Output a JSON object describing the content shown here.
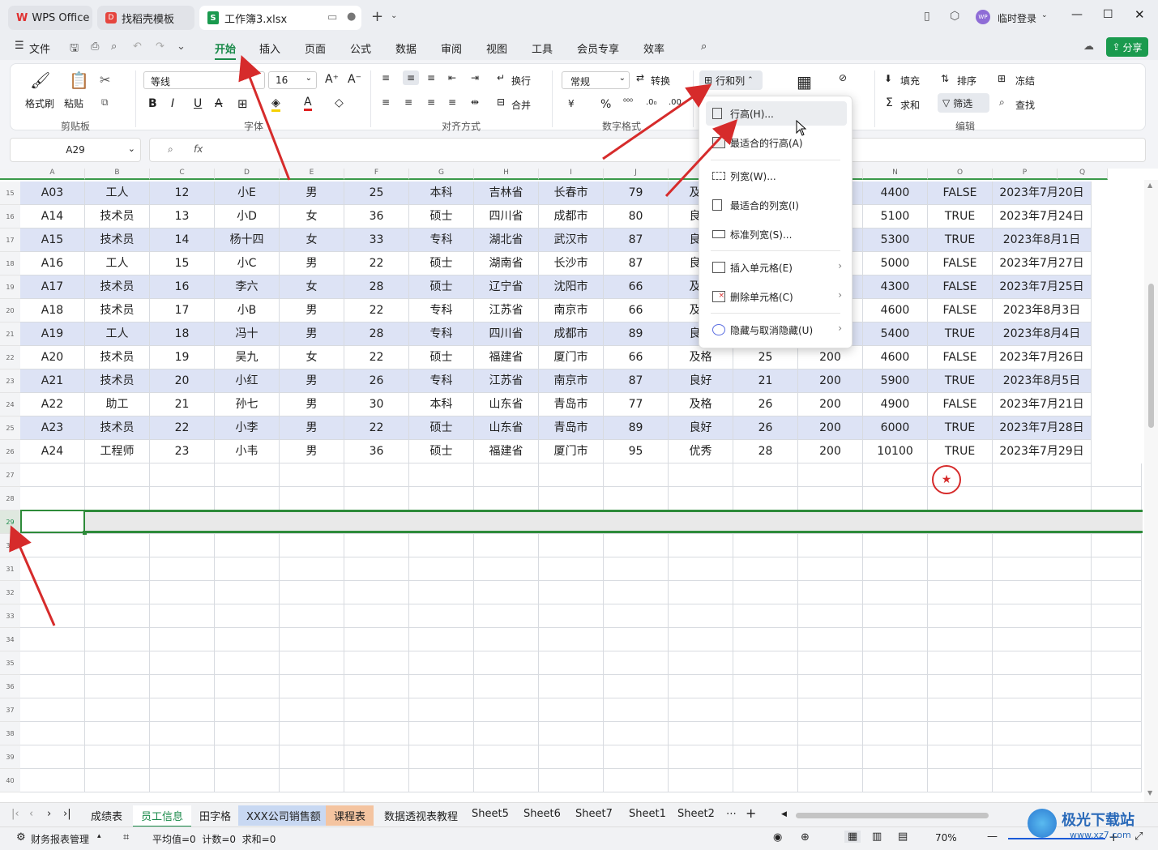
{
  "titlebar": {
    "tabs": [
      {
        "label": "WPS Office"
      },
      {
        "label": "找稻壳模板"
      },
      {
        "label": "工作簿3.xlsx"
      }
    ],
    "user_label": "临时登录",
    "avatar_text": "WP"
  },
  "menubar": {
    "file_label": "文件",
    "items": [
      "开始",
      "插入",
      "页面",
      "公式",
      "数据",
      "审阅",
      "视图",
      "工具",
      "会员专享",
      "效率"
    ],
    "share_label": "分享"
  },
  "ribbon": {
    "format_painter": "格式刷",
    "paste": "粘贴",
    "clipboard_group": "剪贴板",
    "font_name": "等线",
    "font_size": "16",
    "font_group": "字体",
    "wrap": "换行",
    "merge": "合并",
    "align_group": "对齐方式",
    "number_format": "常规",
    "convert": "转换",
    "currency_symbol": "¥",
    "percent_symbol": "%",
    "number_group": "数字格式",
    "rows_cols": "行和列",
    "fill": "填充",
    "sort": "排序",
    "freeze": "冻结",
    "sum": "求和",
    "filter": "筛选",
    "find": "查找",
    "edit_group": "编辑"
  },
  "formula_bar": {
    "cell_ref": "A29",
    "fx": "fx"
  },
  "columns": [
    "A",
    "B",
    "C",
    "D",
    "E",
    "F",
    "G",
    "H",
    "I",
    "J",
    "K",
    "L",
    "M",
    "N",
    "O",
    "P",
    "Q"
  ],
  "rows": [
    {
      "num": "15",
      "cells": [
        "A03",
        "工人",
        "12",
        "小E",
        "男",
        "25",
        "本科",
        "吉林省",
        "长春市",
        "79",
        "及格",
        "",
        "",
        "4400",
        "FALSE",
        "2023年7月20日"
      ]
    },
    {
      "num": "16",
      "cells": [
        "A14",
        "技术员",
        "13",
        "小D",
        "女",
        "36",
        "硕士",
        "四川省",
        "成都市",
        "80",
        "良好",
        "",
        "",
        "5100",
        "TRUE",
        "2023年7月24日"
      ]
    },
    {
      "num": "17",
      "cells": [
        "A15",
        "技术员",
        "14",
        "杨十四",
        "女",
        "33",
        "专科",
        "湖北省",
        "武汉市",
        "87",
        "良好",
        "",
        "",
        "5300",
        "TRUE",
        "2023年8月1日"
      ]
    },
    {
      "num": "18",
      "cells": [
        "A16",
        "工人",
        "15",
        "小C",
        "男",
        "22",
        "硕士",
        "湖南省",
        "长沙市",
        "87",
        "良好",
        "",
        "",
        "5000",
        "FALSE",
        "2023年7月27日"
      ]
    },
    {
      "num": "19",
      "cells": [
        "A17",
        "技术员",
        "16",
        "李六",
        "女",
        "28",
        "硕士",
        "辽宁省",
        "沈阳市",
        "66",
        "及格",
        "",
        "",
        "4300",
        "FALSE",
        "2023年7月25日"
      ]
    },
    {
      "num": "20",
      "cells": [
        "A18",
        "技术员",
        "17",
        "小B",
        "男",
        "22",
        "专科",
        "江苏省",
        "南京市",
        "66",
        "及格",
        "",
        "",
        "4600",
        "FALSE",
        "2023年8月3日"
      ]
    },
    {
      "num": "21",
      "cells": [
        "A19",
        "工人",
        "18",
        "冯十",
        "男",
        "28",
        "专科",
        "四川省",
        "成都市",
        "89",
        "良好",
        "",
        "",
        "5400",
        "TRUE",
        "2023年8月4日"
      ]
    },
    {
      "num": "22",
      "cells": [
        "A20",
        "技术员",
        "19",
        "吴九",
        "女",
        "22",
        "硕士",
        "福建省",
        "厦门市",
        "66",
        "及格",
        "25",
        "200",
        "4600",
        "FALSE",
        "2023年7月26日"
      ]
    },
    {
      "num": "23",
      "cells": [
        "A21",
        "技术员",
        "20",
        "小红",
        "男",
        "26",
        "专科",
        "江苏省",
        "南京市",
        "87",
        "良好",
        "21",
        "200",
        "5900",
        "TRUE",
        "2023年8月5日"
      ]
    },
    {
      "num": "24",
      "cells": [
        "A22",
        "助工",
        "21",
        "孙七",
        "男",
        "30",
        "本科",
        "山东省",
        "青岛市",
        "77",
        "及格",
        "26",
        "200",
        "4900",
        "FALSE",
        "2023年7月21日"
      ]
    },
    {
      "num": "25",
      "cells": [
        "A23",
        "技术员",
        "22",
        "小李",
        "男",
        "22",
        "硕士",
        "山东省",
        "青岛市",
        "89",
        "良好",
        "26",
        "200",
        "6000",
        "TRUE",
        "2023年7月28日"
      ]
    },
    {
      "num": "26",
      "cells": [
        "A24",
        "工程师",
        "23",
        "小韦",
        "男",
        "36",
        "硕士",
        "福建省",
        "厦门市",
        "95",
        "优秀",
        "28",
        "200",
        "10100",
        "TRUE",
        "2023年7月29日"
      ]
    }
  ],
  "empty_rows": [
    "27",
    "28",
    "29",
    "30",
    "31",
    "32",
    "33",
    "34",
    "35",
    "36",
    "37",
    "38",
    "39",
    "40"
  ],
  "context_menu": {
    "items": [
      {
        "label": "行高(H)..."
      },
      {
        "label": "最适合的行高(A)"
      },
      {
        "label": "列宽(W)..."
      },
      {
        "label": "最适合的列宽(I)"
      },
      {
        "label": "标准列宽(S)..."
      },
      {
        "label": "插入单元格(E)"
      },
      {
        "label": "删除单元格(C)"
      },
      {
        "label": "隐藏与取消隐藏(U)"
      }
    ]
  },
  "sheets": [
    "成绩表",
    "员工信息",
    "田字格",
    "XXX公司销售额",
    "课程表",
    "数据透视表教程",
    "Sheet5",
    "Sheet6",
    "Sheet7",
    "Sheet1",
    "Sheet2"
  ],
  "statusbar": {
    "macro": "财务报表管理",
    "stats": "平均值=0  计数=0  求和=0",
    "zoom": "70%"
  },
  "watermark": {
    "text": "极光下载站",
    "url": "www.xz7.com"
  },
  "colors": {
    "accent": "#1a8a4a",
    "band": "#dde3f5",
    "arrow": "#d62b2b",
    "selection": "#2e8b3a"
  }
}
